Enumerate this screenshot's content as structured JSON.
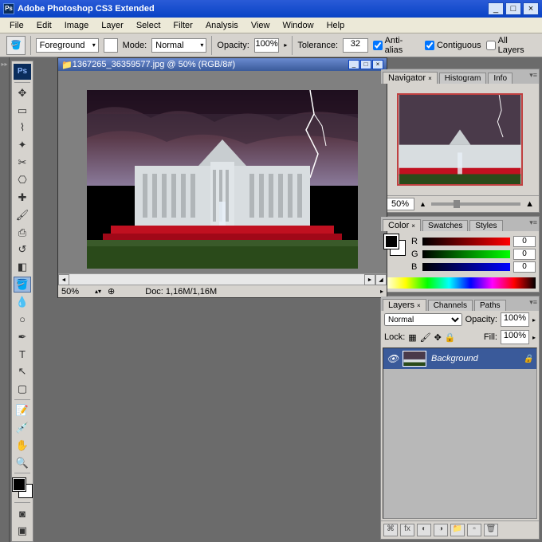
{
  "app": {
    "title": "Adobe Photoshop CS3 Extended",
    "icon_label": "Ps"
  },
  "menu": {
    "items": [
      "File",
      "Edit",
      "Image",
      "Layer",
      "Select",
      "Filter",
      "Analysis",
      "View",
      "Window",
      "Help"
    ]
  },
  "options": {
    "fill_label": "Foreground",
    "mode_label": "Mode:",
    "mode_value": "Normal",
    "opacity_label": "Opacity:",
    "opacity_value": "100%",
    "tolerance_label": "Tolerance:",
    "tolerance_value": "32",
    "antialias_label": "Anti-alias",
    "contiguous_label": "Contiguous",
    "alllayers_label": "All Layers"
  },
  "document": {
    "title": "1367265_36359577.jpg @ 50% (RGB/8#)",
    "status_zoom": "50%",
    "status_doc": "Doc: 1,16M/1,16M"
  },
  "navigator": {
    "tabs": [
      "Navigator",
      "Histogram",
      "Info"
    ],
    "zoom": "50%"
  },
  "color": {
    "tabs": [
      "Color",
      "Swatches",
      "Styles"
    ],
    "r_label": "R",
    "r_val": "0",
    "g_label": "G",
    "g_val": "0",
    "b_label": "B",
    "b_val": "0"
  },
  "layers": {
    "tabs": [
      "Layers",
      "Channels",
      "Paths"
    ],
    "blend_mode": "Normal",
    "opacity_label": "Opacity:",
    "opacity_value": "100%",
    "lock_label": "Lock:",
    "fill_label": "Fill:",
    "fill_value": "100%",
    "items": [
      {
        "name": "Background"
      }
    ]
  }
}
